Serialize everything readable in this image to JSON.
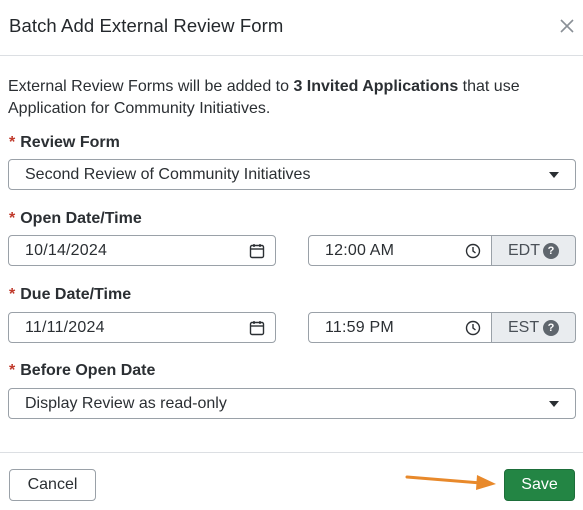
{
  "dialog": {
    "title": "Batch Add External Review Form"
  },
  "intro": {
    "prefix": "External Review Forms will be added to ",
    "highlight": "3 Invited Applications",
    "suffix": " that use Application for Community Initiatives."
  },
  "fields": {
    "required_mark": "*",
    "review_form": {
      "label": "Review Form",
      "value": "Second Review of Community Initiatives"
    },
    "open": {
      "label": "Open Date/Time",
      "date": "10/14/2024",
      "time": "12:00 AM",
      "timezone": "EDT"
    },
    "due": {
      "label": "Due Date/Time",
      "date": "11/11/2024",
      "time": "11:59 PM",
      "timezone": "EST"
    },
    "before_open": {
      "label": "Before Open Date",
      "value": "Display Review as read-only"
    }
  },
  "help_glyph": "?",
  "footer": {
    "cancel_label": "Cancel",
    "save_label": "Save"
  },
  "colors": {
    "save_button": "#238544",
    "required": "#c0392b",
    "annotation_arrow": "#e8892b"
  },
  "icons": [
    "close-icon",
    "chevron-down-icon",
    "calendar-icon",
    "clock-icon",
    "help-icon"
  ]
}
